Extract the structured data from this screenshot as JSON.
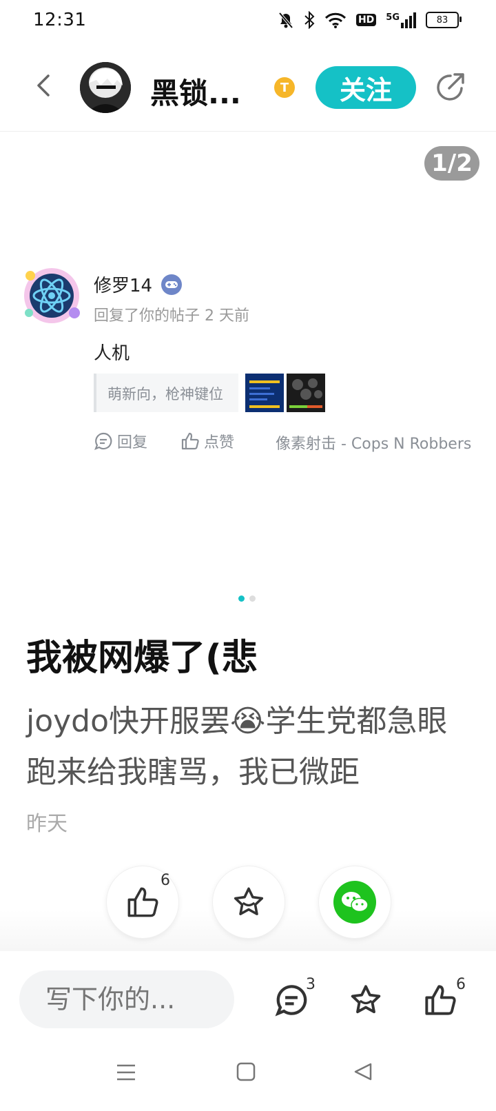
{
  "status_bar": {
    "time": "12:31",
    "battery": "83",
    "network": "5G",
    "hd": "HD"
  },
  "header": {
    "title": "黑锁...",
    "badge": "T",
    "follow_label": "关注"
  },
  "carousel": {
    "page_indicator": "1/2"
  },
  "comment": {
    "username": "修罗14",
    "meta": "回复了你的帖子 2 天前",
    "text": "人机",
    "quote": "萌新向，枪神键位",
    "reply_label": "回复",
    "like_label": "点赞",
    "game_name": "像素射击 - Cops N Robbers"
  },
  "post": {
    "title": "我被网爆了(悲",
    "body": "joydo快开服罢😭学生党都急眼跑来给我瞎骂，我已微距",
    "date": "昨天"
  },
  "reactions": {
    "like_count": "6"
  },
  "bottom_bar": {
    "input_placeholder": "写下你的...",
    "comment_count": "3",
    "like_count": "6"
  },
  "colors": {
    "accent": "#15c1c6",
    "wechat": "#1ec31e",
    "coin": "#f6b629"
  }
}
